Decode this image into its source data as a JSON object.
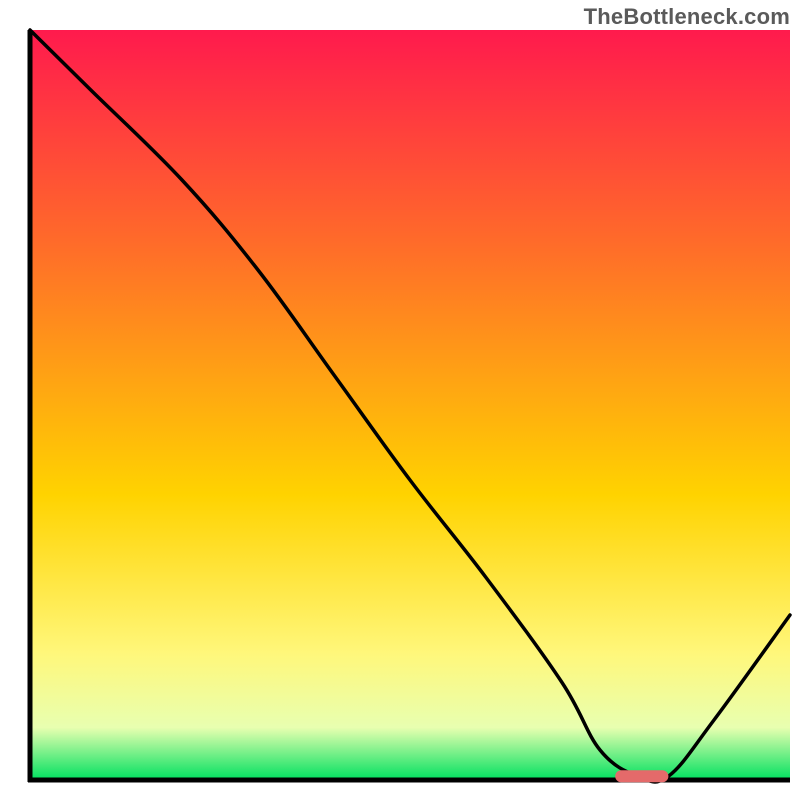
{
  "watermark": "TheBottleneck.com",
  "colors": {
    "gradient_top": "#ff1a4d",
    "gradient_mid1": "#ff6a2a",
    "gradient_mid2": "#ffd300",
    "gradient_low1": "#fff77a",
    "gradient_low2": "#e8ffb0",
    "gradient_bottom": "#00e060",
    "axis": "#000000",
    "curve": "#000000",
    "marker_fill": "#e46a6a",
    "marker_fill_light": "#f2a6a6"
  },
  "chart_data": {
    "type": "line",
    "title": "",
    "xlabel": "",
    "ylabel": "",
    "xlim": [
      0,
      100
    ],
    "ylim": [
      0,
      100
    ],
    "grid": false,
    "series": [
      {
        "name": "bottleneck-curve",
        "x": [
          0,
          8,
          20,
          30,
          40,
          50,
          60,
          70,
          75,
          80,
          84,
          90,
          100
        ],
        "y": [
          100,
          92,
          80,
          68,
          54,
          40,
          27,
          13,
          4,
          0.5,
          0.5,
          8,
          22
        ]
      }
    ],
    "optimal_marker": {
      "x_start": 77,
      "x_end": 84,
      "y": 0.5
    },
    "legend": null
  }
}
